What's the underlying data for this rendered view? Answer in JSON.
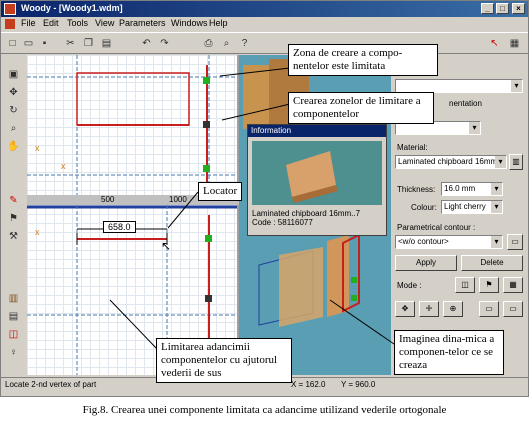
{
  "window": {
    "title": "Woody - [Woody1.wdm]"
  },
  "title_buttons": [
    "_",
    "□",
    "×"
  ],
  "menu": [
    "File",
    "Edit",
    "Tools",
    "View",
    "Parameters",
    "Windows",
    "Help"
  ],
  "toolbar_icons": [
    "new-icon",
    "open-icon",
    "save-icon",
    "cut-icon",
    "copy-icon",
    "paste-icon",
    "undo-icon",
    "redo-icon",
    "print-icon",
    "preview-icon",
    "help-icon"
  ],
  "left_tool_icons": [
    "select-icon",
    "move-icon",
    "rotate-icon",
    "zoom-icon",
    "pan-icon",
    "paint-icon",
    "pin-icon",
    "cabinet-icon",
    "tool-icon"
  ],
  "scale": {
    "ticks": [
      "500",
      "1000"
    ]
  },
  "front_view": {
    "dimension_label": "658.0"
  },
  "info_panel": {
    "title": "Information",
    "material_line": "Laminated chipboard 16mm..7",
    "code_line": "Code : 58116077"
  },
  "right_panel": {
    "combo_top": "",
    "partial_label": "nentation",
    "material_label": "Material:",
    "material_value": "Laminated chipboard 16mm",
    "thickness_label": "Thickness:",
    "thickness_value": "16.0 mm",
    "colour_label": "Colour:",
    "colour_value": "Light cherry",
    "contour_label": "Parametrical contour :",
    "contour_value": "<w/o contour>",
    "apply_label": "Apply",
    "delete_label": "Delete",
    "mode_label": "Mode :"
  },
  "status": {
    "message": "Locate 2-nd vertex of part",
    "x": "X = 162.0",
    "y": "Y = 960.0"
  },
  "callouts": {
    "zona": "Zona de creare a compo-nentelor este limitata",
    "crearea": "Crearea zonelor de limitare a componentelor",
    "locator": "Locator",
    "limitarea": "Limitarea adancimii componentelor cu ajutorul vederii de sus",
    "imaginea": "Imaginea dina-mica a componen-telor ce se creaza"
  },
  "caption": "Fig.8. Crearea unei componente limitata ca adancime utilizand vederile ortogonale"
}
